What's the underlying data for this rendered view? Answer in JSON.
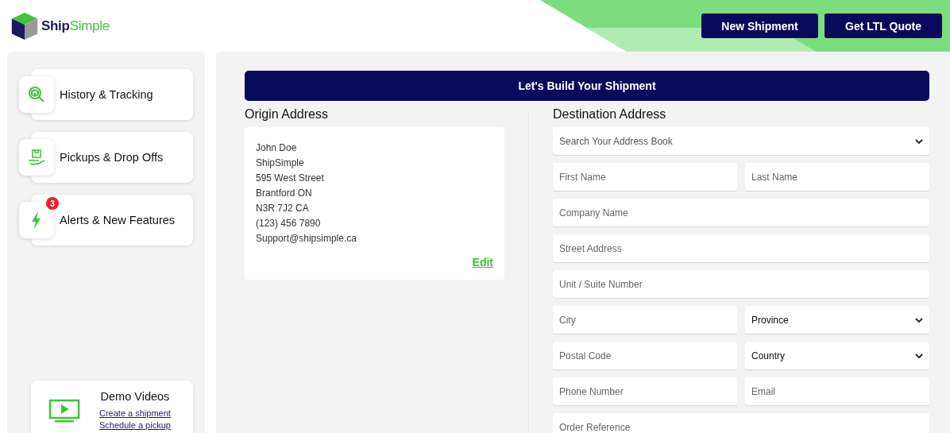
{
  "logo": {
    "first": "Ship",
    "second": "Simple"
  },
  "header_buttons": [
    "New Shipment",
    "Get LTL Quote"
  ],
  "sidebar": {
    "items": [
      {
        "label": "History & Tracking"
      },
      {
        "label": "Pickups & Drop Offs"
      },
      {
        "label": "Alerts & New Features",
        "badge": "3"
      }
    ],
    "demo": {
      "title": "Demo Videos",
      "links": [
        "Create a shipment",
        "Schedule a pickup"
      ]
    }
  },
  "banner": "Let's Build Your Shipment",
  "origin": {
    "heading": "Origin Address",
    "lines": [
      "John Doe",
      "ShipSimple",
      "595 West Street",
      "Brantford ON",
      "N3R 7J2 CA",
      "(123) 456 7890",
      "Support@shipsimple.ca"
    ],
    "edit": "Edit"
  },
  "destination": {
    "heading": "Destination Address",
    "rows": [
      [
        {
          "kind": "select",
          "placeholder": "Search Your Address Book"
        }
      ],
      [
        {
          "kind": "input",
          "placeholder": "First Name"
        },
        {
          "kind": "input",
          "placeholder": "Last Name"
        }
      ],
      [
        {
          "kind": "input",
          "placeholder": "Company Name"
        }
      ],
      [
        {
          "kind": "input",
          "placeholder": "Street Address"
        }
      ],
      [
        {
          "kind": "input",
          "placeholder": "Unit / Suite Number"
        }
      ],
      [
        {
          "kind": "input",
          "placeholder": "City"
        },
        {
          "kind": "select",
          "value": "Province"
        }
      ],
      [
        {
          "kind": "input",
          "placeholder": "Postal Code"
        },
        {
          "kind": "select",
          "value": "Country"
        }
      ],
      [
        {
          "kind": "input",
          "placeholder": "Phone Number"
        },
        {
          "kind": "input",
          "placeholder": "Email"
        }
      ],
      [
        {
          "kind": "input",
          "placeholder": "Order Reference"
        }
      ]
    ]
  }
}
